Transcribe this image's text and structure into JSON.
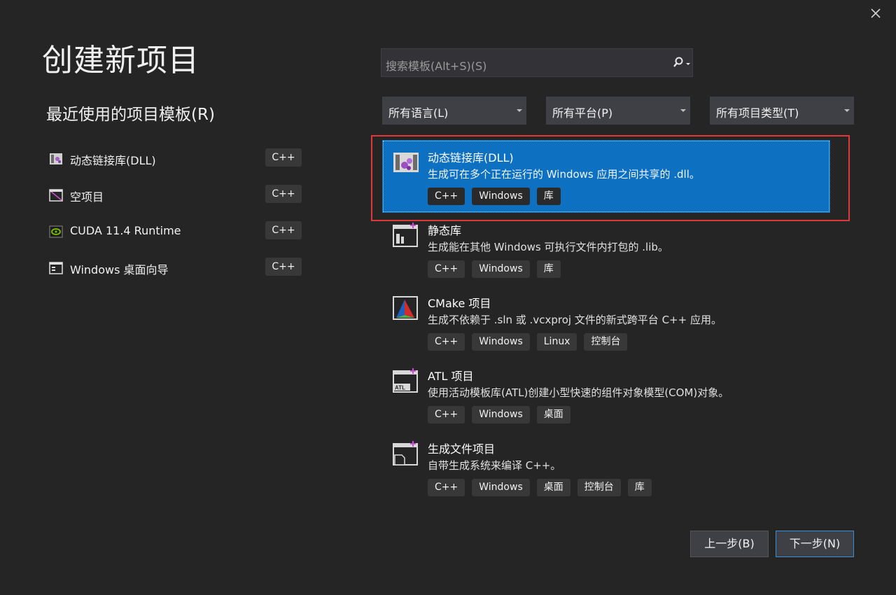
{
  "window": {
    "title": "创建新项目"
  },
  "recent": {
    "title": "最近使用的项目模板(R)",
    "items": [
      {
        "label": "动态链接库(DLL)",
        "tag": "C++",
        "icon": "dll-library-icon"
      },
      {
        "label": "空项目",
        "tag": "C++",
        "icon": "empty-project-icon"
      },
      {
        "label": "CUDA 11.4 Runtime",
        "tag": "C++",
        "icon": "nvidia-cuda-icon"
      },
      {
        "label": "Windows 桌面向导",
        "tag": "C++",
        "icon": "desktop-wizard-icon"
      }
    ]
  },
  "search": {
    "placeholder": "搜索模板(Alt+S)(S)"
  },
  "filters": {
    "language": "所有语言(L)",
    "platform": "所有平台(P)",
    "project_type": "所有项目类型(T)"
  },
  "templates": [
    {
      "name": "动态链接库(DLL)",
      "description": "生成可在多个正在运行的 Windows 应用之间共享的 .dll。",
      "tags": [
        "C++",
        "Windows",
        "库"
      ],
      "selected": true,
      "icon": "dll-library-icon"
    },
    {
      "name": "静态库",
      "description": "生成能在其他 Windows 可执行文件内打包的 .lib。",
      "tags": [
        "C++",
        "Windows",
        "库"
      ],
      "selected": false,
      "icon": "static-library-icon"
    },
    {
      "name": "CMake 项目",
      "description": "生成不依赖于 .sln 或 .vcxproj 文件的新式跨平台 C++ 应用。",
      "tags": [
        "C++",
        "Windows",
        "Linux",
        "控制台"
      ],
      "selected": false,
      "icon": "cmake-icon"
    },
    {
      "name": "ATL 项目",
      "description": "使用活动模板库(ATL)创建小型快速的组件对象模型(COM)对象。",
      "tags": [
        "C++",
        "Windows",
        "桌面"
      ],
      "selected": false,
      "icon": "atl-project-icon"
    },
    {
      "name": "生成文件项目",
      "description": "自带生成系统来编译 C++。",
      "tags": [
        "C++",
        "Windows",
        "桌面",
        "控制台",
        "库"
      ],
      "selected": false,
      "icon": "makefile-project-icon"
    }
  ],
  "buttons": {
    "back": "上一步(B)",
    "next": "下一步(N)"
  },
  "colors": {
    "background": "#252526",
    "selection": "#0e70c0",
    "highlight_frame": "#e0373a"
  }
}
